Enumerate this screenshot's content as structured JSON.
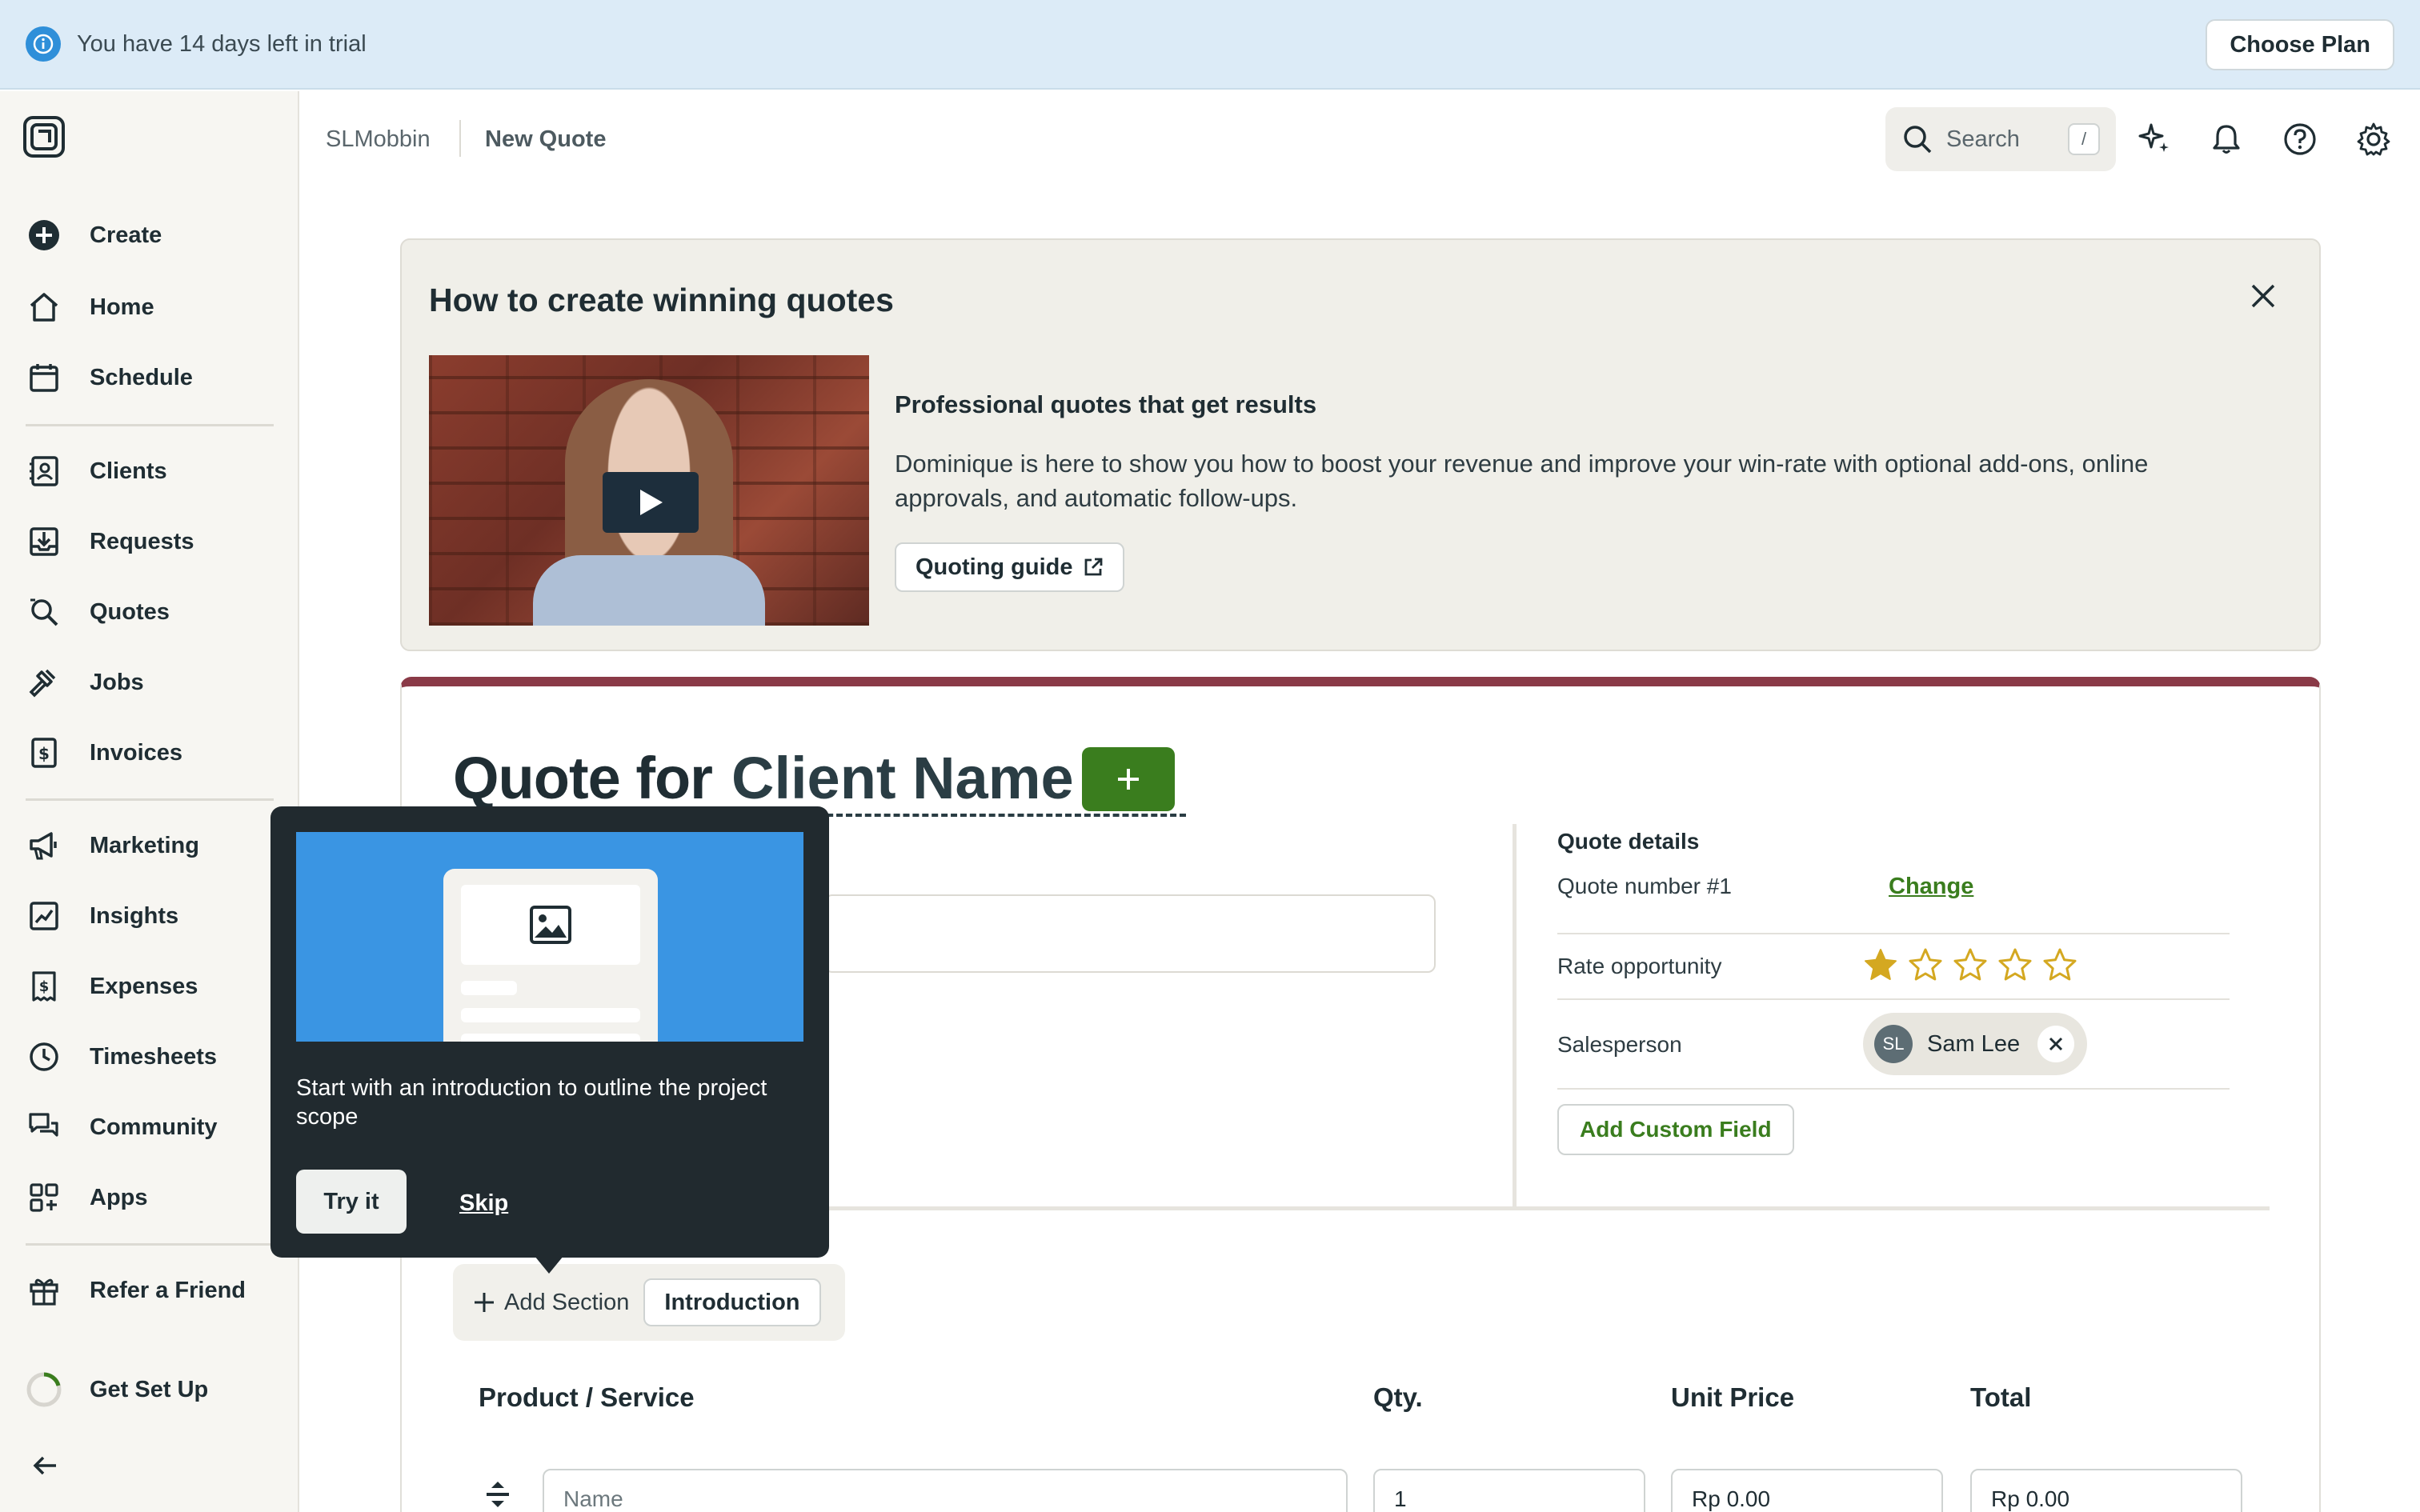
{
  "trial": {
    "text": "You have 14 days left in trial",
    "cta": "Choose Plan"
  },
  "sidebar": {
    "items": [
      {
        "label": "Create",
        "icon": "plus-circle-icon"
      },
      {
        "label": "Home",
        "icon": "home-icon"
      },
      {
        "label": "Schedule",
        "icon": "calendar-icon"
      },
      {
        "label": "Clients",
        "icon": "contact-card-icon"
      },
      {
        "label": "Requests",
        "icon": "inbox-download-icon"
      },
      {
        "label": "Quotes",
        "icon": "search-document-icon"
      },
      {
        "label": "Jobs",
        "icon": "hammer-icon"
      },
      {
        "label": "Invoices",
        "icon": "dollar-document-icon"
      },
      {
        "label": "Marketing",
        "icon": "megaphone-icon"
      },
      {
        "label": "Insights",
        "icon": "chart-icon"
      },
      {
        "label": "Expenses",
        "icon": "receipt-icon"
      },
      {
        "label": "Timesheets",
        "icon": "clock-icon"
      },
      {
        "label": "Community",
        "icon": "chat-bubbles-icon"
      },
      {
        "label": "Apps",
        "icon": "apps-grid-icon"
      },
      {
        "label": "Refer a Friend",
        "icon": "gift-icon"
      },
      {
        "label": "Get Set Up",
        "icon": "progress-ring-icon"
      }
    ]
  },
  "header": {
    "breadcrumb_account": "SLMobbin",
    "breadcrumb_page": "New Quote",
    "search_label": "Search",
    "search_shortcut": "/"
  },
  "tips": {
    "title": "How to create winning quotes",
    "subtitle": "Professional quotes that get results",
    "description": "Dominique is here to show you how to boost your revenue and improve your win-rate with optional add-ons, online approvals, and automatic follow-ups.",
    "guide_button": "Quoting guide"
  },
  "quote": {
    "title_prefix": "Quote for",
    "client_placeholder": "Client Name",
    "details": {
      "title": "Quote details",
      "quote_number": "Quote number #1",
      "change_label": "Change",
      "rate_label": "Rate opportunity",
      "rating": 1,
      "rating_max": 5,
      "salesperson_label": "Salesperson",
      "salesperson_initials": "SL",
      "salesperson_name": "Sam Lee",
      "add_custom_field": "Add Custom Field"
    },
    "add_section": "Add Section",
    "introduction": "Introduction",
    "columns": {
      "product": "Product / Service",
      "qty": "Qty.",
      "unit_price": "Unit Price",
      "total": "Total"
    },
    "row": {
      "name_placeholder": "Name",
      "qty": "1",
      "unit_price": "Rp 0.00",
      "total": "Rp 0.00"
    }
  },
  "popover": {
    "text": "Start with an introduction to outline the project scope",
    "try_label": "Try it",
    "skip_label": "Skip"
  },
  "colors": {
    "accent_green": "#3a7d1e",
    "quote_accent": "#8a3a47",
    "star": "#d4a821",
    "info_blue": "#2f8fd9"
  }
}
